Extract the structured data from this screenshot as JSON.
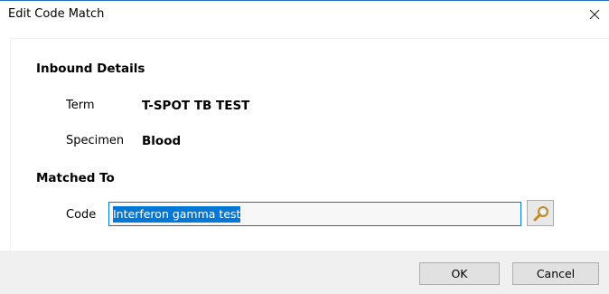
{
  "window": {
    "title": "Edit Code Match",
    "close_icon": "close-icon",
    "accent_color": "#0078d7"
  },
  "inbound": {
    "heading": "Inbound Details",
    "term_label": "Term",
    "term_value": "T-SPOT TB TEST",
    "specimen_label": "Specimen",
    "specimen_value": "Blood"
  },
  "matched": {
    "heading": "Matched To",
    "code_label": "Code",
    "code_value": "Interferon gamma test",
    "search_icon": "search-icon"
  },
  "footer": {
    "ok_label": "OK",
    "cancel_label": "Cancel"
  }
}
